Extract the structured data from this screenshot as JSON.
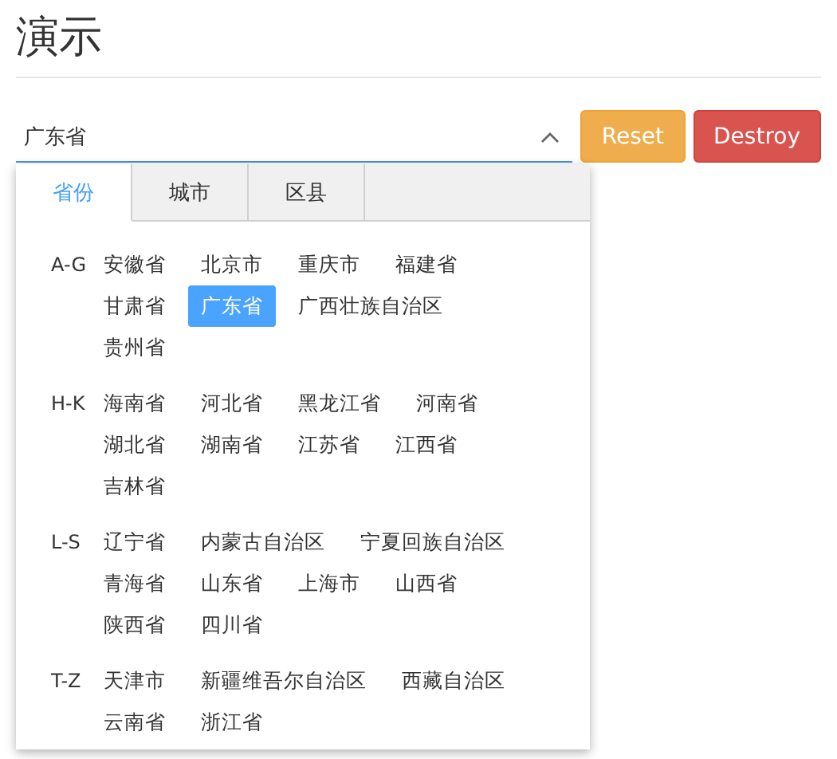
{
  "heading": "演示",
  "picker": {
    "value": "广东省",
    "expanded": true
  },
  "buttons": [
    {
      "label": "Reset",
      "kind": "warning"
    },
    {
      "label": "Destroy",
      "kind": "danger"
    }
  ],
  "tabs": [
    {
      "label": "省份",
      "selected": true
    },
    {
      "label": "城市",
      "selected": false
    },
    {
      "label": "区县",
      "selected": false
    }
  ],
  "groups": [
    {
      "label": "A-G",
      "items": [
        {
          "label": "安徽省",
          "selected": false
        },
        {
          "label": "北京市",
          "selected": false
        },
        {
          "label": "重庆市",
          "selected": false
        },
        {
          "label": "福建省",
          "selected": false
        },
        {
          "label": "甘肃省",
          "selected": false
        },
        {
          "label": "广东省",
          "selected": true
        },
        {
          "label": "广西壮族自治区",
          "selected": false
        },
        {
          "label": "贵州省",
          "selected": false
        }
      ]
    },
    {
      "label": "H-K",
      "items": [
        {
          "label": "海南省",
          "selected": false
        },
        {
          "label": "河北省",
          "selected": false
        },
        {
          "label": "黑龙江省",
          "selected": false
        },
        {
          "label": "河南省",
          "selected": false
        },
        {
          "label": "湖北省",
          "selected": false
        },
        {
          "label": "湖南省",
          "selected": false
        },
        {
          "label": "江苏省",
          "selected": false
        },
        {
          "label": "江西省",
          "selected": false
        },
        {
          "label": "吉林省",
          "selected": false
        }
      ]
    },
    {
      "label": "L-S",
      "items": [
        {
          "label": "辽宁省",
          "selected": false
        },
        {
          "label": "内蒙古自治区",
          "selected": false
        },
        {
          "label": "宁夏回族自治区",
          "selected": false
        },
        {
          "label": "青海省",
          "selected": false
        },
        {
          "label": "山东省",
          "selected": false
        },
        {
          "label": "上海市",
          "selected": false
        },
        {
          "label": "山西省",
          "selected": false
        },
        {
          "label": "陕西省",
          "selected": false
        },
        {
          "label": "四川省",
          "selected": false
        }
      ]
    },
    {
      "label": "T-Z",
      "items": [
        {
          "label": "天津市",
          "selected": false
        },
        {
          "label": "新疆维吾尔自治区",
          "selected": false
        },
        {
          "label": "西藏自治区",
          "selected": false
        },
        {
          "label": "云南省",
          "selected": false
        },
        {
          "label": "浙江省",
          "selected": false
        }
      ]
    }
  ]
}
